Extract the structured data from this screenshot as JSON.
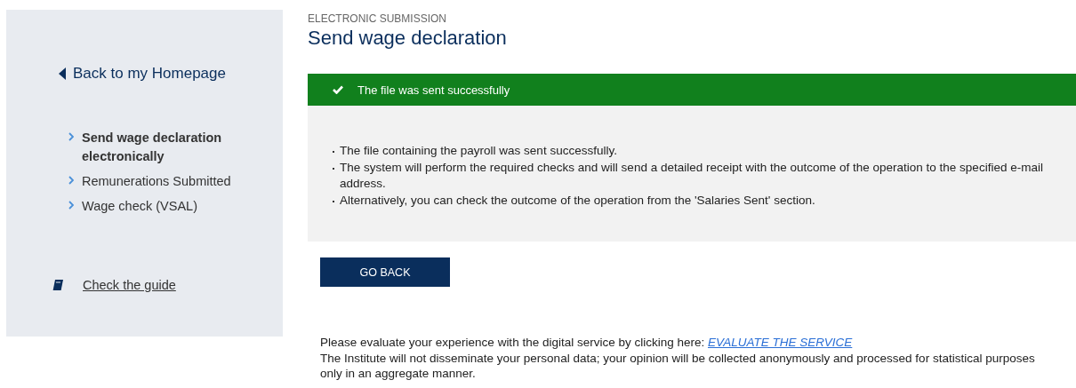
{
  "sidebar": {
    "back_link": "Back to my Homepage",
    "items": [
      {
        "label": "Send wage declaration electronically",
        "selected": true
      },
      {
        "label": "Remunerations Submitted",
        "selected": false
      },
      {
        "label": "Wage check (VSAL)",
        "selected": false
      }
    ],
    "guide_link": "Check the guide"
  },
  "header": {
    "overline": "ELECTRONIC SUBMISSION",
    "title": "Send wage declaration"
  },
  "alert": {
    "message": "The file was sent successfully",
    "points": [
      "The file containing the payroll was sent successfully.",
      "The system will perform the required checks and will send a detailed receipt with the outcome of the operation to the specified e-mail address.",
      "Alternatively, you can check the outcome of the operation from the 'Salaries Sent' section."
    ]
  },
  "button": "GO BACK",
  "feedback": {
    "prompt": "Please evaluate your experience with the digital service by clicking here:",
    "link": "EVALUATE THE SERVICE",
    "note": "The Institute will not disseminate your personal data; your opinion will be collected anonymously and processed for statistical purposes only in an aggregate manner."
  }
}
